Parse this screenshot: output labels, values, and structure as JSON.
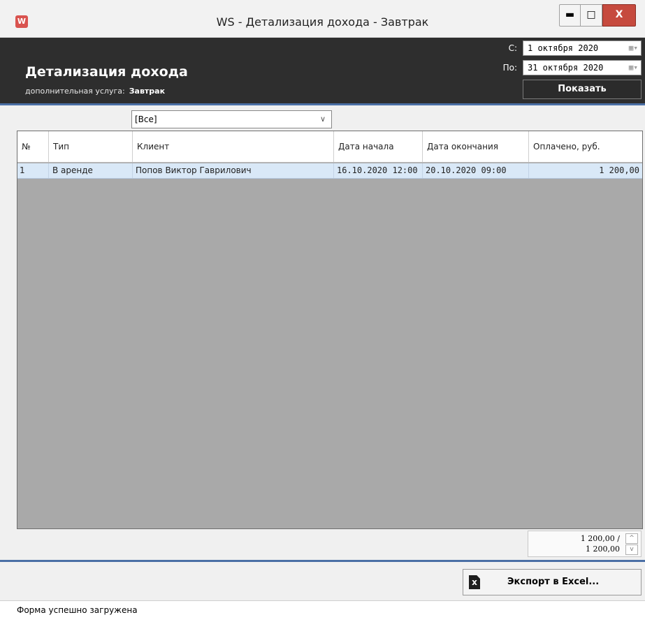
{
  "window": {
    "title": "WS - Детализация дохода - Завтрак",
    "app_icon": "W",
    "min_glyph": "▬",
    "max_glyph": "□",
    "close_glyph": "X"
  },
  "header": {
    "title": "Детализация дохода",
    "service_label": "дополнительная услуга:",
    "service_value": "Завтрак",
    "from_label": "С:",
    "from_value": "1 октября  2020",
    "to_label": "По:",
    "to_value": "31 октября  2020",
    "calendar_glyph": "▦▾",
    "show_button": "Показать"
  },
  "filter": {
    "value": "[Все]",
    "chevron": "∨"
  },
  "table": {
    "columns": [
      "№",
      "Тип",
      "Клиент",
      "Дата начала",
      "Дата окончания",
      "Оплачено, руб."
    ],
    "rows": [
      [
        "1",
        "В аренде",
        "Попов Виктор Гаврилович",
        "16.10.2020 12:00",
        "20.10.2020 09:00",
        "1 200,00"
      ]
    ]
  },
  "totals": {
    "line1": "1 200,00 /",
    "line2": "1 200,00",
    "up": "^",
    "down": "v"
  },
  "export_button": "Экспорт в Excel...",
  "status": "Форма успешно загружена",
  "colors": {
    "header_bg": "#2e2e2e",
    "row_selected": "#d9e8f7",
    "grid_empty": "#a9a9a9",
    "accent_line": "#4a6fa5",
    "close_button": "#c64a3e"
  }
}
